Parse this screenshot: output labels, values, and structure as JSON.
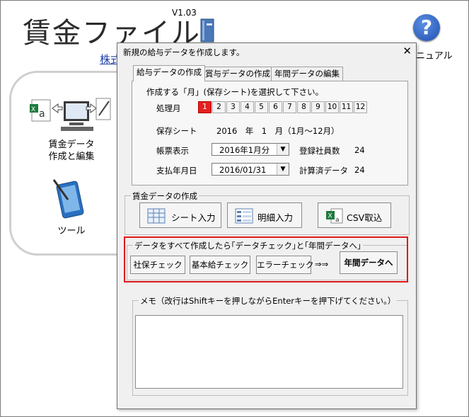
{
  "app": {
    "title": "賃金ファイル",
    "version": "V1.03",
    "company_link": "株式",
    "manual_label": "ニュアル"
  },
  "left_panel": {
    "tiles": [
      {
        "label_line1": "賃金データ",
        "label_line2": "作成と編集",
        "icon": "pc-excel-icon"
      },
      {
        "label_line1": "ツール",
        "icon": "tablet-pen-icon"
      }
    ]
  },
  "dialog": {
    "title": "新規の給与データを作成します。",
    "close_label": "✕",
    "tabs": [
      {
        "label": "給与データの作成",
        "active": true
      },
      {
        "label": "賞与データの作成",
        "active": false
      },
      {
        "label": "年間データの編集",
        "active": false
      }
    ],
    "instruction": "作成する「月」(保存シート)を選択して下さい。",
    "month_label": "処理月",
    "months": [
      "1",
      "2",
      "3",
      "4",
      "5",
      "6",
      "7",
      "8",
      "9",
      "10",
      "11",
      "12"
    ],
    "selected_month": "1",
    "save_sheet_label": "保存シート",
    "save_sheet_value": "2016　年　1　月（1月〜12月）",
    "form_display_label": "帳票表示",
    "form_display_value": "2016年1月分",
    "registered_label": "登録社員数",
    "registered_count": "24",
    "pay_date_label": "支払年月日",
    "pay_date_value": "2016/01/31",
    "calculated_label": "計算済データ",
    "calculated_count": "24",
    "wage_group_label": "賃金データの作成",
    "wage_buttons": {
      "sheet_input": "シート入力",
      "detail_input": "明細入力",
      "csv_import": "CSV取込"
    },
    "check_group_label": "データをすべて作成したら｢データチェック｣と｢年間データへ｣",
    "check_buttons": {
      "social_insurance": "社保チェック",
      "base_salary": "基本給チェック",
      "error_check": "エラーチェック",
      "arrow": "⇒⇒",
      "to_annual": "年間データへ"
    },
    "memo_label": "メモ（改行はShiftキーを押しながらEnterキーを押下げてください。）",
    "memo_value": ""
  },
  "colors": {
    "selected_month": "#e61e1e",
    "highlight_box": "#e01818",
    "link": "#1f3fa8"
  }
}
